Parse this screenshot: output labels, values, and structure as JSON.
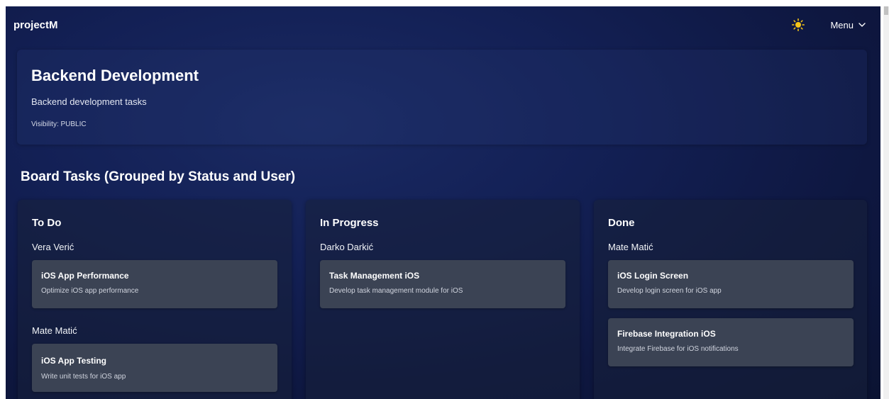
{
  "app": {
    "brand": "projectM",
    "menu_label": "Menu",
    "theme_icon": "sun-icon"
  },
  "board": {
    "title": "Backend Development",
    "description": "Backend development tasks",
    "visibility": "Visibility: PUBLIC"
  },
  "section_title": "Board Tasks (Grouped by Status and User)",
  "columns": [
    {
      "title": "To Do",
      "groups": [
        {
          "user": "Vera Verić",
          "tasks": [
            {
              "title": "iOS App Performance",
              "description": "Optimize iOS app performance"
            }
          ]
        },
        {
          "user": "Mate Matić",
          "tasks": [
            {
              "title": "iOS App Testing",
              "description": "Write unit tests for iOS app"
            }
          ]
        }
      ]
    },
    {
      "title": "In Progress",
      "groups": [
        {
          "user": "Darko Darkić",
          "tasks": [
            {
              "title": "Task Management iOS",
              "description": "Develop task management module for iOS"
            }
          ]
        }
      ]
    },
    {
      "title": "Done",
      "groups": [
        {
          "user": "Mate Matić",
          "tasks": [
            {
              "title": "iOS Login Screen",
              "description": "Develop login screen for iOS app"
            },
            {
              "title": "Firebase Integration iOS",
              "description": "Integrate Firebase for iOS notifications"
            }
          ]
        }
      ]
    }
  ],
  "colors": {
    "background": "#132055",
    "card": "#3b4354",
    "sun": "#f5c518"
  }
}
